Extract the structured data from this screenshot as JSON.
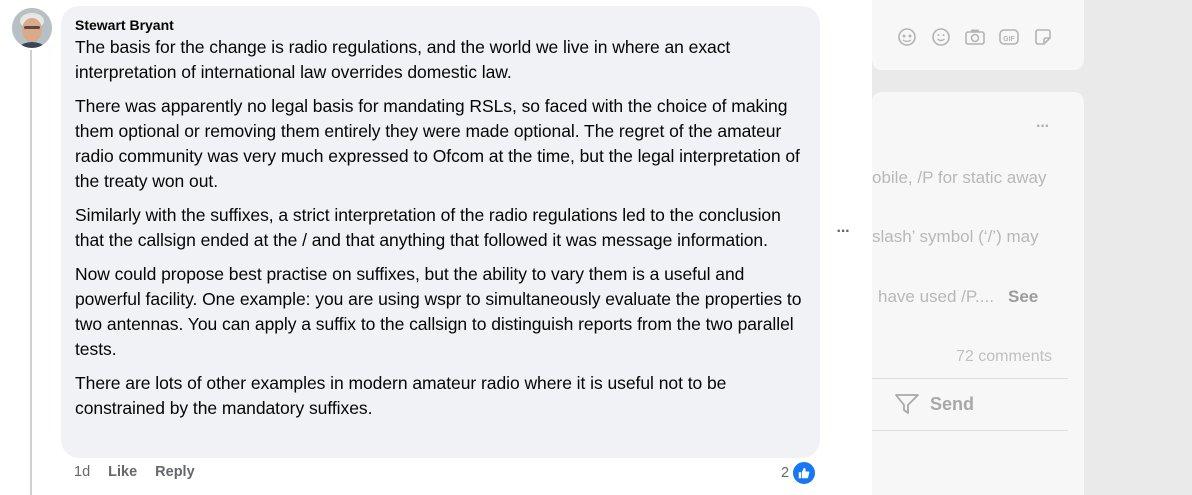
{
  "comment": {
    "author": "Stewart Bryant",
    "paragraphs": [
      "The basis for the change is radio regulations, and the world we live in where an exact interpretation of international law overrides domestic law.",
      "There was apparently no legal basis for mandating RSLs, so faced with the choice of making them optional or removing them entirely they were made optional. The regret of the amateur radio community was very much expressed to Ofcom at the time, but the legal interpretation of the treaty won out.",
      "Similarly with the suffixes, a strict interpretation of the radio regulations led to the conclusion that the callsign ended at the / and that anything that followed it was message information.",
      "Now could propose best practise on suffixes, but the ability to vary them is a useful and powerful facility. One example: you are using wspr to simultaneously evaluate the properties to two antennas. You can apply a suffix to the callsign to distinguish reports from the two parallel tests.",
      "There are lots of other examples in modern amateur radio where it is useful not to be constrained by the mandatory suffixes."
    ],
    "timestamp": "1d",
    "like_label": "Like",
    "reply_label": "Reply",
    "reaction_count": "2",
    "more_label": "···"
  },
  "background_post": {
    "more_label": "···",
    "line1": "obile, /P for static away",
    "line2": "slash’ symbol (‘/’) may",
    "line3": "have used /P....",
    "see_more": "See",
    "comments": "72 comments",
    "send_label": "Send",
    "composer_icons": [
      "avatar-sticker-icon",
      "smiley-icon",
      "camera-icon",
      "gif-icon",
      "sticker-icon"
    ]
  },
  "colors": {
    "bubble": "#f0f2f5",
    "accent": "#1877f2",
    "secondary_text": "#65676b"
  }
}
